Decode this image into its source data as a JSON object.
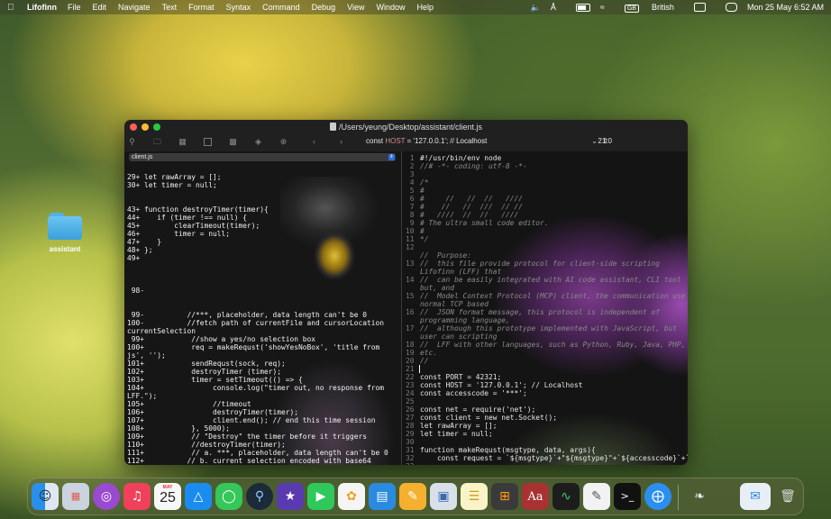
{
  "menubar": {
    "app_name": "Lifofinn",
    "menus": [
      "File",
      "Edit",
      "Navigate",
      "Text",
      "Format",
      "Syntax",
      "Command",
      "Debug",
      "View",
      "Window",
      "Help"
    ],
    "input_source": "GB",
    "input_label": "British",
    "datetime": "Mon 25 May  6:52 AM"
  },
  "desktop": {
    "folder_label": "assistant"
  },
  "window": {
    "title": "/Users/yeung/Desktop/assistant/client.js",
    "toolbar": {
      "symbol_prefix": "const ",
      "symbol_name": "HOST",
      "symbol_suffix": " = '127.0.0.1'; // Localhost",
      "cursor_position": "21:0"
    },
    "left_pane": {
      "file_name": "client.js",
      "code": "29+ let rawArray = [];\n30+ let timer = null;\n\n\n43+ function destroyTimer(timer){\n44+    if (timer !== null) {\n45+        clearTimeout(timer);\n46+        timer = null;\n47+    }\n48+ };\n49+\n\n\n\n 98-\n\n\n 99-          //***, placeholder, data length can't be 0\n100-          //fetch path of currentFile and cursorLocation\ncurrentSelection\n 99+           //show a yes/no selection box\n100+           req = makeRequst('showYesNoBox', 'title from\njs', '');\n101+           sendRequst(sock, req);\n102+           destroyTimer (timer);\n103+           timer = setTimeout(() => {\n104+                console.log(\"timer out, no response from\nLFF.\");\n105+                //timeout\n106+                destroyTimer(timer);\n107+                client.end(); // end this time session\n108+           }, 5000);\n109+           // \"Destroy\" the timer before it triggers\n110+           //destroyTimer(timer);\n111+           // a. ***, placeholder, data length can't be 0\n112+          // b. current selection encoded with base64"
    },
    "right_pane": {
      "line_numbers": "1\n2\n3\n4\n5\n6\n7\n8\n9\n10\n11\n12\n\n13\n\n14\n\n15\n\n16\n\n17\n\n18\n19\n20\n21\n22\n23\n24\n25\n26\n27\n28\n29\n30\n31\n32\n33",
      "code_header": "#!/usr/bin/env node",
      "code_comments": "//# -*- coding: utf-8 -*-\n\n/*\n#\n#     //   //  //   ////\n#    //   //  ///  // //\n#   ////  //  //   ////\n# The ultra small code editor.\n#\n*/\n\n//  Purpose:\n//  this file provide protocol for client-side scripting\nLifofinn (LFF) that\n//  can be easily integrated with AI code assistant, CLI tool\nbut, and\n//  Model Context Protocol (MCP) client, the communication use\nnormal TCP based\n//  JSON format message, this protocol is independent of\nprogramming language,\n//  although this prototype implemented with JavaScript, but\nuser can scripting\n//  LFF with other languages, such as Python, Ruby, Java, PHP,\netc.\n//",
      "code_body": "\n\nconst PORT = 42321;\nconst HOST = '127.0.0.1'; // Localhost\nconst accesscode = '***';\n\nconst net = require('net');\nconst client = new net.Socket();\nlet rawArray = [];\nlet timer = null;\n\nfunction makeRequst(msgtype, data, args){\n    const request = `${msgtype}`+\"${msgtype}\"+`${accesscode}`+`"
    }
  },
  "dock": {
    "calendar_month": "MAY",
    "calendar_day": "25",
    "dictionary_label": "Aa",
    "apps": [
      "Finder",
      "Launchpad",
      "Podcasts",
      "Music",
      "Calendar",
      "App Store",
      "Messages",
      "QuickTime Player",
      "iMovie",
      "FaceTime",
      "Photos",
      "Keynote",
      "Pages",
      "Preview",
      "Notes",
      "Calculator",
      "Dictionary",
      "Activity Monitor",
      "TextEdit",
      "Terminal",
      "Safari",
      "Migration Assistant",
      "Mail",
      "Trash"
    ]
  }
}
